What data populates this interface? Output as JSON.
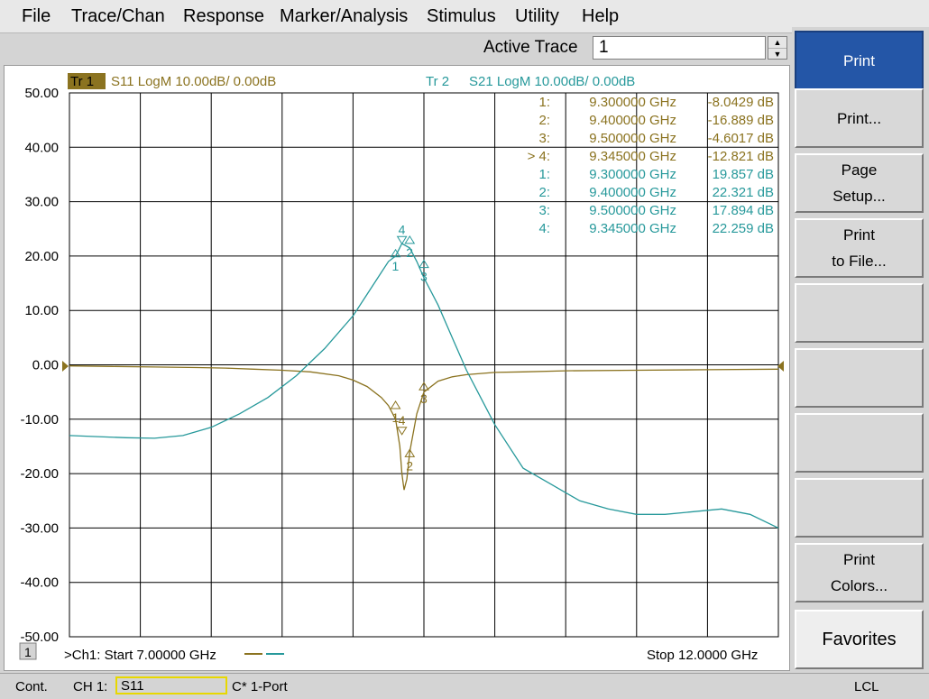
{
  "menu": [
    "File",
    "Trace/Chan",
    "Response",
    "Marker/Analysis",
    "Stimulus",
    "Utility",
    "Help"
  ],
  "toolbar": {
    "active_trace_label": "Active Trace",
    "active_trace_value": "1"
  },
  "softkeys": [
    {
      "label": "Print",
      "active": true
    },
    {
      "label": "Print..."
    },
    {
      "label": "Page\nSetup..."
    },
    {
      "label": "Print\nto File..."
    },
    {
      "label": ""
    },
    {
      "label": ""
    },
    {
      "label": ""
    },
    {
      "label": ""
    },
    {
      "label": "Print\nColors..."
    },
    {
      "label": "Favorites",
      "fav": true
    }
  ],
  "status": {
    "mode": "Cont.",
    "channel": "CH 1:",
    "param": "S11",
    "cal": "C* 1-Port",
    "lcl": "LCL"
  },
  "chart_data": {
    "type": "line",
    "x_unit": "GHz",
    "xlim": [
      7.0,
      12.0
    ],
    "ylim": [
      -50,
      50
    ],
    "ytick_labels": [
      "50.00",
      "40.00",
      "30.00",
      "20.00",
      "10.00",
      "0.00",
      "-10.00",
      "-20.00",
      "-30.00",
      "-40.00",
      "-50.00"
    ],
    "grid": true,
    "channel_label": "1",
    "start_text": ">Ch1: Start  7.00000 GHz",
    "stop_text": "Stop  12.0000 GHz",
    "colors": {
      "tr1": "#8b7320",
      "tr2": "#27999b"
    },
    "traces": [
      {
        "tag": "Tr  1",
        "label": "S11 LogM 10.00dB/  0.00dB"
      },
      {
        "tag": "Tr  2",
        "label": "S21 LogM 10.00dB/  0.00dB"
      }
    ],
    "marker_table": [
      {
        "trace": 1,
        "num": "1:",
        "freq": "9.300000 GHz",
        "value": "-8.0429 dB"
      },
      {
        "trace": 1,
        "num": "2:",
        "freq": "9.400000 GHz",
        "value": "-16.889 dB"
      },
      {
        "trace": 1,
        "num": "3:",
        "freq": "9.500000 GHz",
        "value": "-4.6017 dB"
      },
      {
        "trace": 1,
        "num": "> 4:",
        "freq": "9.345000 GHz",
        "value": "-12.821 dB"
      },
      {
        "trace": 2,
        "num": "1:",
        "freq": "9.300000 GHz",
        "value": "19.857 dB"
      },
      {
        "trace": 2,
        "num": "2:",
        "freq": "9.400000 GHz",
        "value": "22.321 dB"
      },
      {
        "trace": 2,
        "num": "3:",
        "freq": "9.500000 GHz",
        "value": "17.894 dB"
      },
      {
        "trace": 2,
        "num": "4:",
        "freq": "9.345000 GHz",
        "value": "22.259 dB"
      }
    ],
    "series": [
      {
        "x": [
          7.0,
          7.3,
          7.6,
          7.9,
          8.1,
          8.3,
          8.5,
          8.7,
          8.9,
          9.0,
          9.1,
          9.2,
          9.25,
          9.3,
          9.33,
          9.345,
          9.36,
          9.38,
          9.4,
          9.45,
          9.5,
          9.6,
          9.7,
          9.8,
          9.9,
          10.0,
          10.2,
          10.5,
          11.0,
          11.5,
          12.0
        ],
        "y": [
          -0.2,
          -0.3,
          -0.4,
          -0.5,
          -0.6,
          -0.8,
          -1.0,
          -1.3,
          -2.0,
          -2.8,
          -4.0,
          -6.0,
          -7.5,
          -10.0,
          -15.0,
          -20.0,
          -23.0,
          -21.0,
          -16.0,
          -9.0,
          -5.0,
          -3.0,
          -2.2,
          -1.8,
          -1.6,
          -1.4,
          -1.3,
          -1.1,
          -1.0,
          -0.9,
          -0.8
        ]
      },
      {
        "x": [
          7.0,
          7.2,
          7.4,
          7.6,
          7.8,
          8.0,
          8.2,
          8.4,
          8.6,
          8.8,
          9.0,
          9.1,
          9.2,
          9.25,
          9.3,
          9.345,
          9.4,
          9.45,
          9.5,
          9.6,
          9.7,
          9.8,
          9.9,
          10.0,
          10.2,
          10.4,
          10.6,
          10.8,
          11.0,
          11.2,
          11.4,
          11.6,
          11.8,
          12.0
        ],
        "y": [
          -13.0,
          -13.2,
          -13.4,
          -13.5,
          -13.0,
          -11.5,
          -9.0,
          -6.0,
          -2.0,
          3.0,
          9.0,
          13.0,
          17.0,
          19.0,
          20.0,
          22.3,
          21.5,
          19.0,
          16.0,
          11.0,
          5.0,
          -1.0,
          -6.0,
          -11.0,
          -19.0,
          -22.0,
          -25.0,
          -26.5,
          -27.5,
          -27.5,
          -27.0,
          -26.5,
          -27.5,
          -30.0
        ]
      }
    ],
    "markers": [
      {
        "trace": 1,
        "label": "1",
        "x": 9.3,
        "y": -8.0429
      },
      {
        "trace": 1,
        "label": "2",
        "x": 9.4,
        "y": -16.889
      },
      {
        "trace": 1,
        "label": "3",
        "x": 9.5,
        "y": -4.6017
      },
      {
        "trace": 1,
        "label": "4",
        "x": 9.345,
        "y": -12.821
      },
      {
        "trace": 2,
        "label": "1",
        "x": 9.3,
        "y": 19.857
      },
      {
        "trace": 2,
        "label": "2",
        "x": 9.4,
        "y": 22.321
      },
      {
        "trace": 2,
        "label": "3",
        "x": 9.5,
        "y": 17.894
      },
      {
        "trace": 2,
        "label": "4",
        "x": 9.345,
        "y": 22.259
      }
    ]
  }
}
